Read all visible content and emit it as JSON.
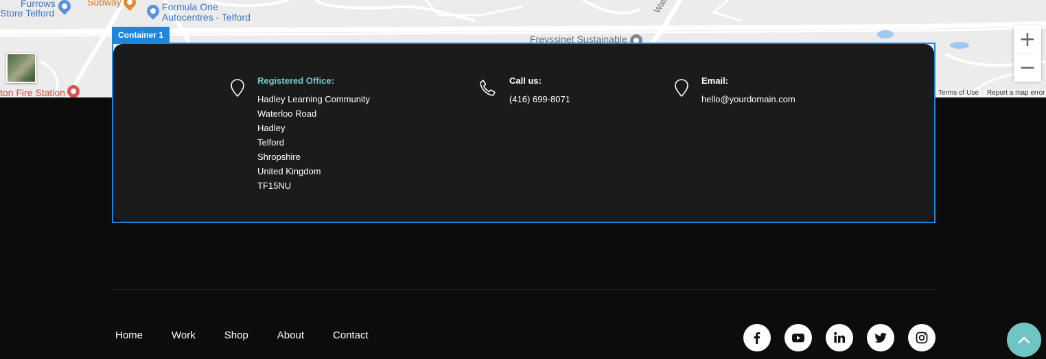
{
  "map": {
    "pois": [
      {
        "label_line1": "Furrows",
        "label_line2": "Store Telford",
        "icon": "shopping-bag-icon"
      },
      {
        "label_line1": "Subway",
        "icon": "restaurant-icon"
      },
      {
        "label_line1": "Formula One",
        "label_line2": "Autocentres - Telford",
        "icon": "car-service-icon"
      },
      {
        "label_line1": "Freyssinet Sustainable",
        "icon": "business-icon"
      },
      {
        "label_line1": "Waterloo",
        "icon": "road-label"
      },
      {
        "label_line1": "ton Fire Station",
        "icon": "fire-station-icon"
      }
    ],
    "zoom_in": "+",
    "zoom_out": "−",
    "terms": "Terms of Use",
    "report": "Report a map error"
  },
  "editor": {
    "container_label": "Container 1",
    "accent": "#1c87dd"
  },
  "contact": {
    "office": {
      "title": "Registered Office:",
      "lines": [
        "Hadley Learning Community",
        "Waterloo Road",
        "Hadley",
        "Telford",
        "Shropshire",
        "United Kingdom",
        "TF15NU"
      ],
      "icon": "map-pin-icon"
    },
    "call": {
      "title": "Call us:",
      "phone": "(416) 699-8071",
      "icon": "phone-icon"
    },
    "email": {
      "title": "Email:",
      "address": "hello@yourdomain.com",
      "icon": "map-pin-icon"
    },
    "title_accent": "#77c8c8"
  },
  "footer": {
    "nav": [
      "Home",
      "Work",
      "Shop",
      "About",
      "Contact"
    ],
    "social": [
      "facebook-icon",
      "youtube-icon",
      "linkedin-icon",
      "twitter-icon",
      "instagram-icon"
    ],
    "scroll_top_color": "#6ec5c4"
  }
}
